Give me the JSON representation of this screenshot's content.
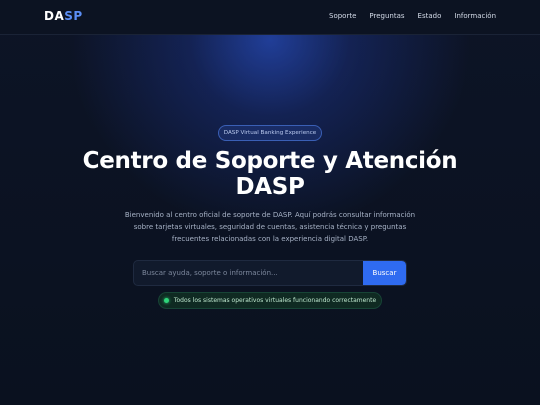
{
  "brand": {
    "logo_main": "DA",
    "logo_accent": "SP"
  },
  "nav": {
    "items": [
      {
        "label": "Soporte"
      },
      {
        "label": "Preguntas"
      },
      {
        "label": "Estado"
      },
      {
        "label": "Información"
      }
    ]
  },
  "hero": {
    "badge": "DASP Virtual Banking Experience",
    "title_line1": "Centro de Soporte y Atención",
    "title_line2": "DASP",
    "description": "Bienvenido al centro oficial de soporte de DASP. Aquí podrás consultar información sobre tarjetas virtuales, seguridad de cuentas, asistencia técnica y preguntas frecuentes relacionadas con la experiencia digital DASP."
  },
  "search": {
    "placeholder": "Buscar ayuda, soporte o información...",
    "value": "",
    "button_label": "Buscar"
  },
  "status": {
    "text": "Todos los sistemas operativos virtuales funcionando correctamente",
    "color": "#2fd57a"
  },
  "colors": {
    "accent": "#2f6bf0",
    "logo_accent": "#5b8ef5",
    "background": "#0b1220"
  }
}
